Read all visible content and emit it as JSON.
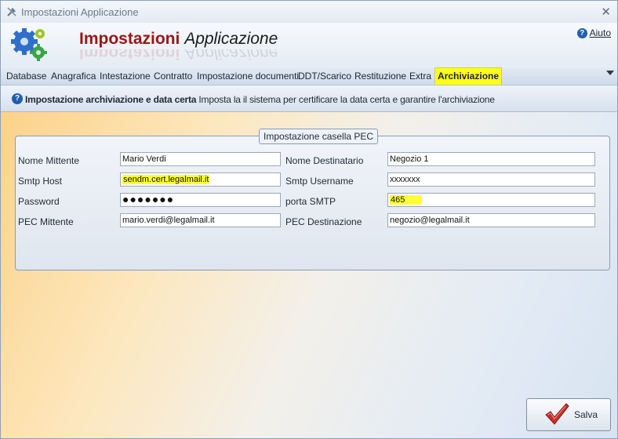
{
  "window": {
    "title": "Impostazioni Applicazione"
  },
  "header": {
    "title_part1": "Impostazioni",
    "title_part2": "Applicazione",
    "help_label": "Aiuto"
  },
  "tabs": [
    {
      "label": "Database"
    },
    {
      "label": "Anagrafica"
    },
    {
      "label": "Intestazione"
    },
    {
      "label": "Contratto"
    },
    {
      "label": "Impostazione documenti"
    },
    {
      "label": "DDT/Scarico"
    },
    {
      "label": "Restituzione"
    },
    {
      "label": "Extra"
    },
    {
      "label": "Archiviazione",
      "active": true
    }
  ],
  "infobar": {
    "bold": "Impostazione archiviazione e data certa",
    "text": "Imposta la il sistema per certificare la data certa e garantire l'archiviazione"
  },
  "pec": {
    "legend": "Impostazione casella PEC",
    "nome_mittente_label": "Nome Mittente",
    "nome_mittente_value": "Mario Verdi",
    "nome_destinatario_label": "Nome Destinatario",
    "nome_destinatario_value": "Negozio 1",
    "smtp_host_label": "Smtp Host",
    "smtp_host_value": "sendm.cert.legalmail.it",
    "smtp_username_label": "Smtp Username",
    "smtp_username_value": "xxxxxxx",
    "password_label": "Password",
    "password_value": "●●●●●●●",
    "porta_smtp_label": "porta SMTP",
    "porta_smtp_value": "465",
    "pec_mittente_label": "PEC Mittente",
    "pec_mittente_value": "mario.verdi@legalmail.it",
    "pec_destinazione_label": "PEC Destinazione",
    "pec_destinazione_value": "negozio@legalmail.it"
  },
  "save_label": "Salva",
  "colors": {
    "highlight": "#ffff33",
    "title_red": "#9b1515",
    "accent_blue": "#1f5fb0"
  }
}
